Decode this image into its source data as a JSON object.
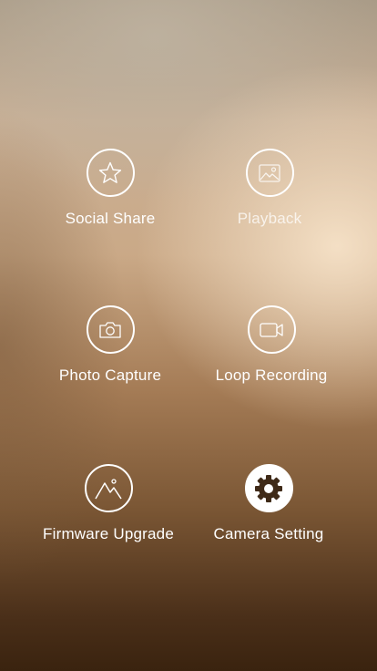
{
  "menu": {
    "items": [
      {
        "label": "Social Share",
        "icon": "star-icon"
      },
      {
        "label": "Playback",
        "icon": "image-icon"
      },
      {
        "label": "Photo Capture",
        "icon": "camera-icon"
      },
      {
        "label": "Loop Recording",
        "icon": "video-camera-icon"
      },
      {
        "label": "Firmware Upgrade",
        "icon": "mountain-icon"
      },
      {
        "label": "Camera Setting",
        "icon": "gear-icon"
      }
    ]
  }
}
